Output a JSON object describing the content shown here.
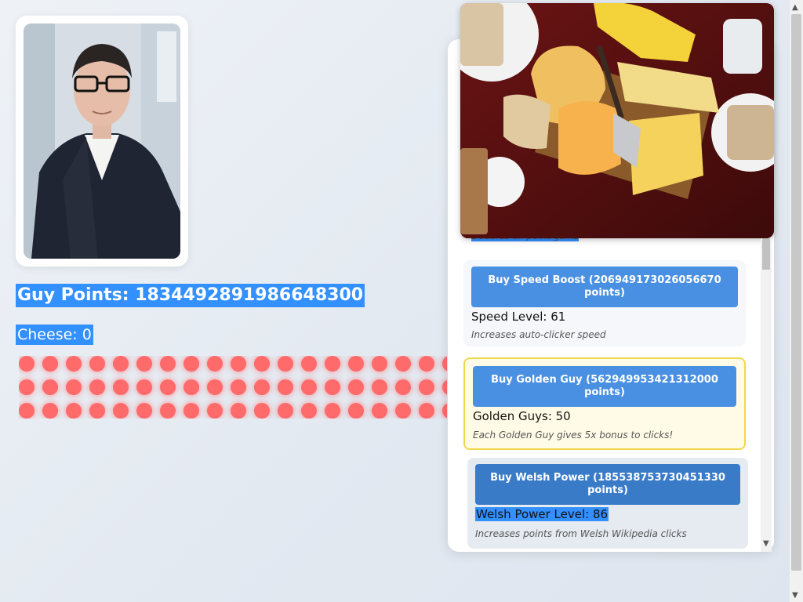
{
  "score": {
    "guy_points_label": "Guy Points: 1834492891986648300",
    "cheese_label": "Cheese: 0"
  },
  "shop": {
    "partial_desc": "Doubles all point gains",
    "upgrades": [
      {
        "button": "Buy Speed Boost (206949173026056670 points)",
        "level": "Speed Level: 61",
        "desc": "Increases auto-clicker speed"
      },
      {
        "button": "Buy Golden Guy (562949953421312000 points)",
        "level": "Golden Guys: 50",
        "desc": "Each Golden Guy gives 5x bonus to clicks!"
      },
      {
        "button": "Buy Welsh Power (185538753730451330 points)",
        "level": "Welsh Power Level: 86",
        "desc": "Increases points from Welsh Wikipedia clicks"
      }
    ]
  },
  "colors": {
    "accent": "#4a90e2",
    "dot": "#ff6b6b",
    "golden_border": "#f0d84a"
  }
}
